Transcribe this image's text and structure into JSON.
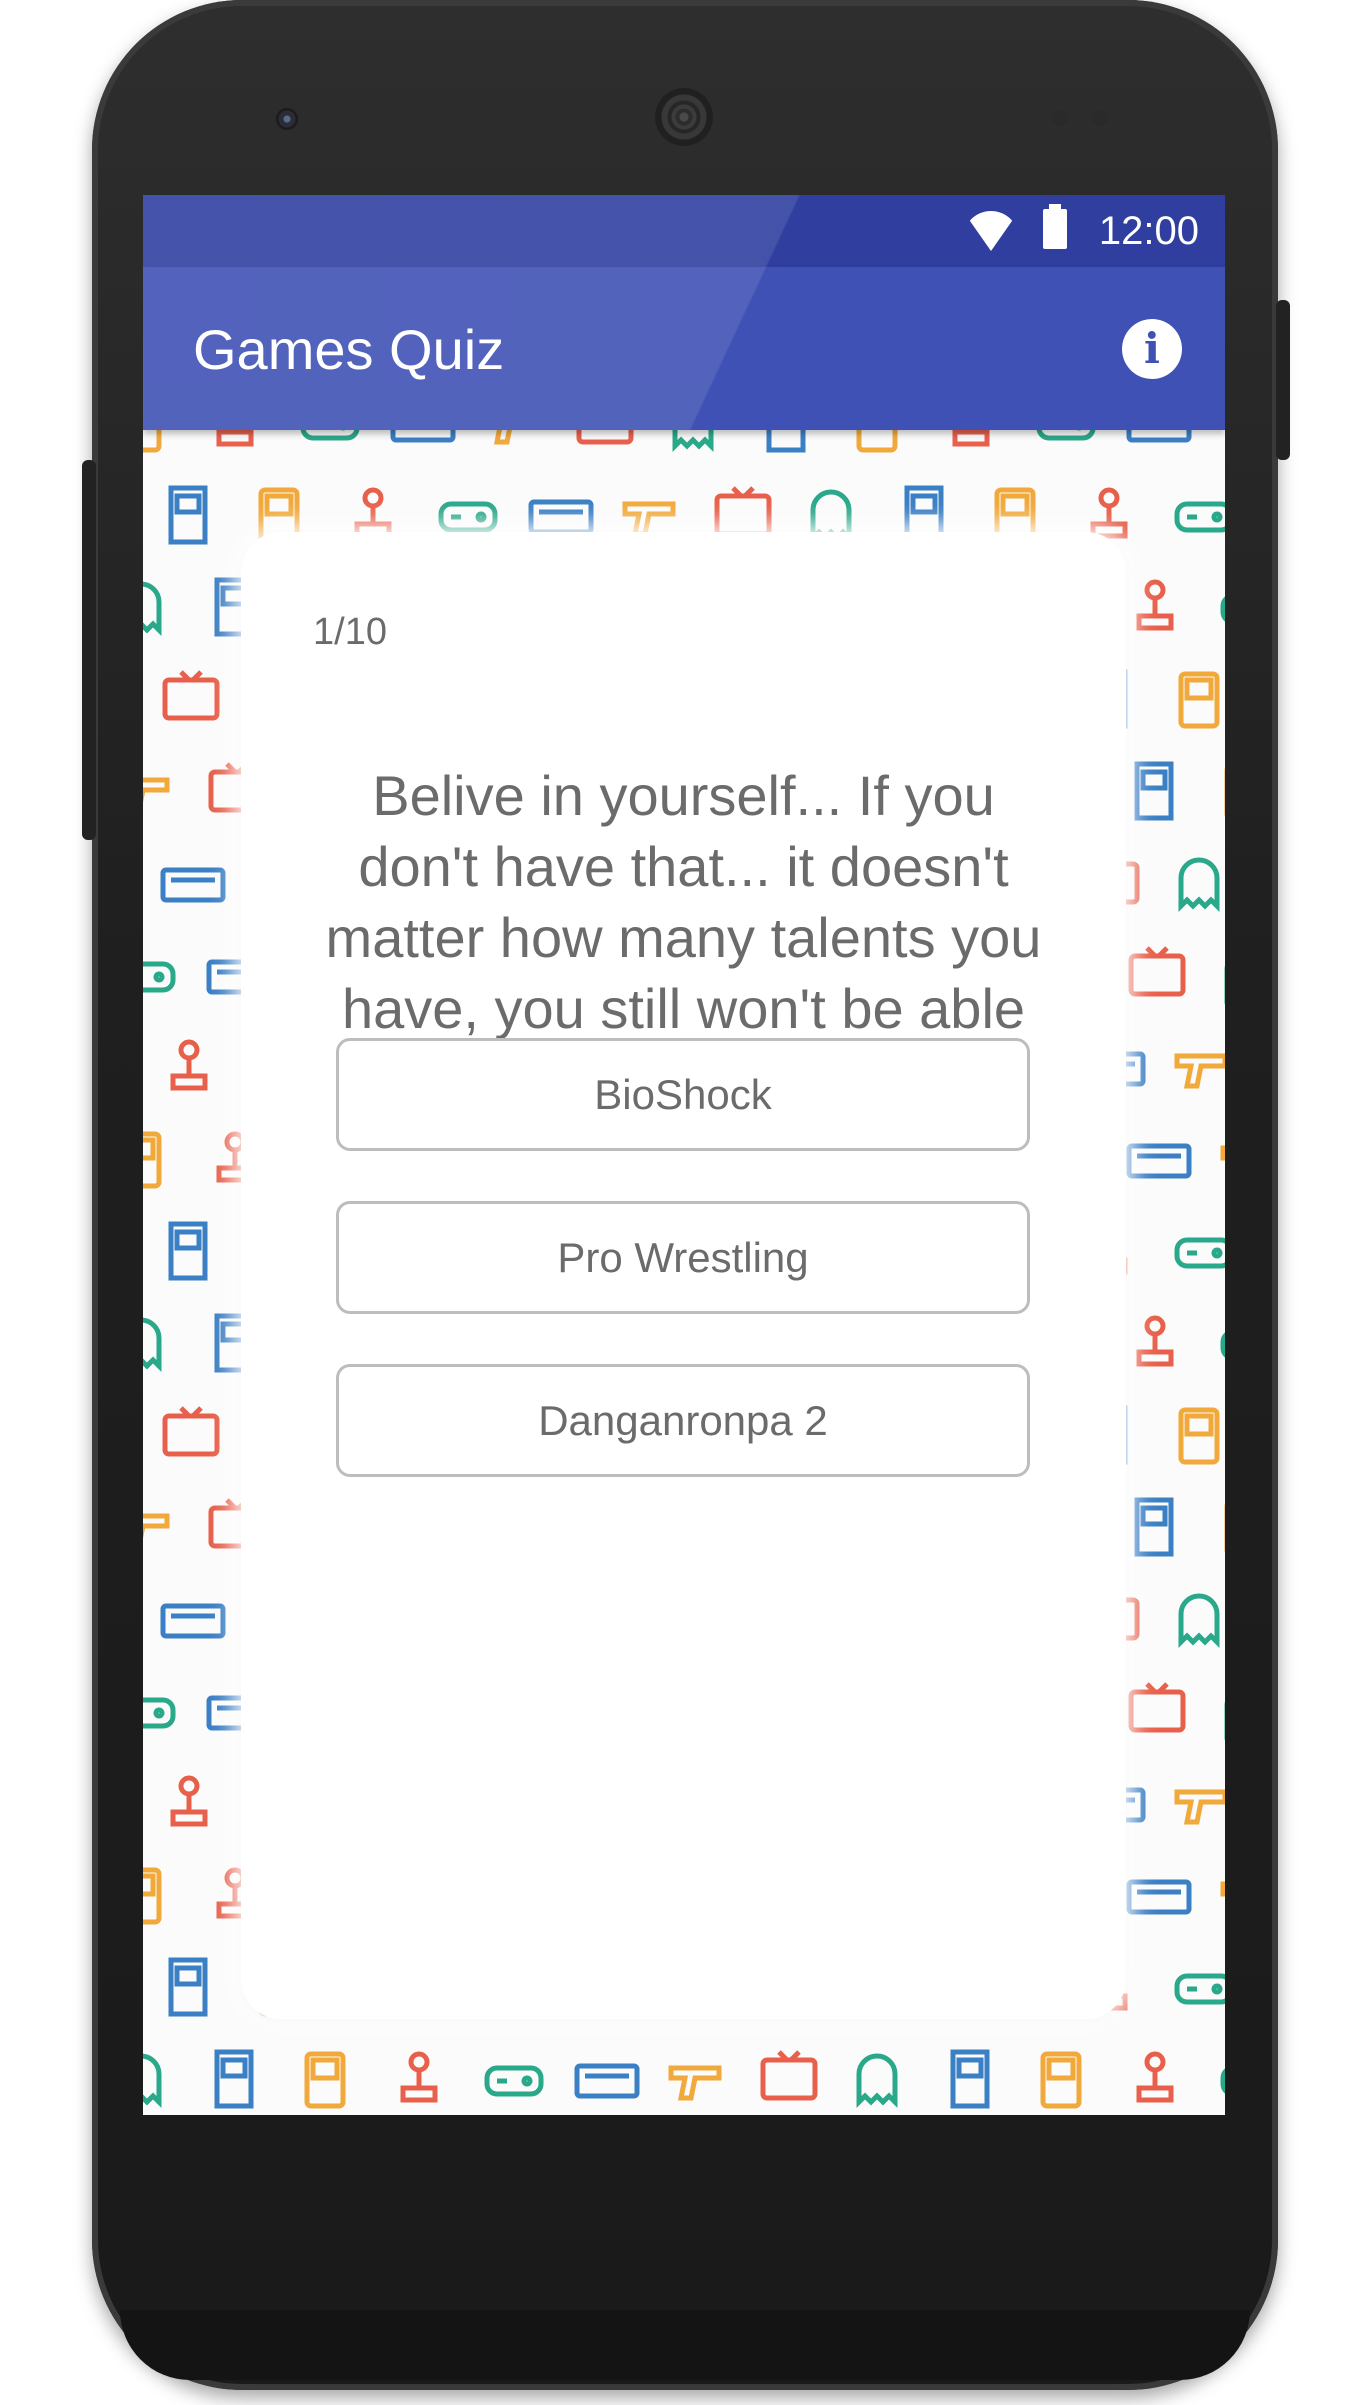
{
  "status_bar": {
    "time": "12:00",
    "icons": [
      "wifi-icon",
      "battery-icon"
    ]
  },
  "app_bar": {
    "title": "Games Quiz",
    "action_icon": "info-icon",
    "action_glyph": "i"
  },
  "quiz": {
    "counter": "1/10",
    "question": "Belive in yourself... If you don't have that... it doesn't matter how many talents you have, you still won't be able to hold your head up high...",
    "answers": [
      "BioShock",
      "Pro Wrestling",
      "Danganronpa 2"
    ]
  },
  "colors": {
    "status_bar": "#303f9f",
    "app_bar": "#3f51b5",
    "text_gray": "#6b6b6b",
    "pattern_colors": [
      "#f2a93b",
      "#e8604c",
      "#2aa88a",
      "#3b7fc4"
    ]
  },
  "background_pattern_icons": [
    "gameboy-icon",
    "retro-console-icon",
    "pacman-ghost-icon",
    "joystick-icon",
    "light-gun-icon",
    "arcade-cabinet-icon",
    "gamepad-icon",
    "tv-icon"
  ]
}
